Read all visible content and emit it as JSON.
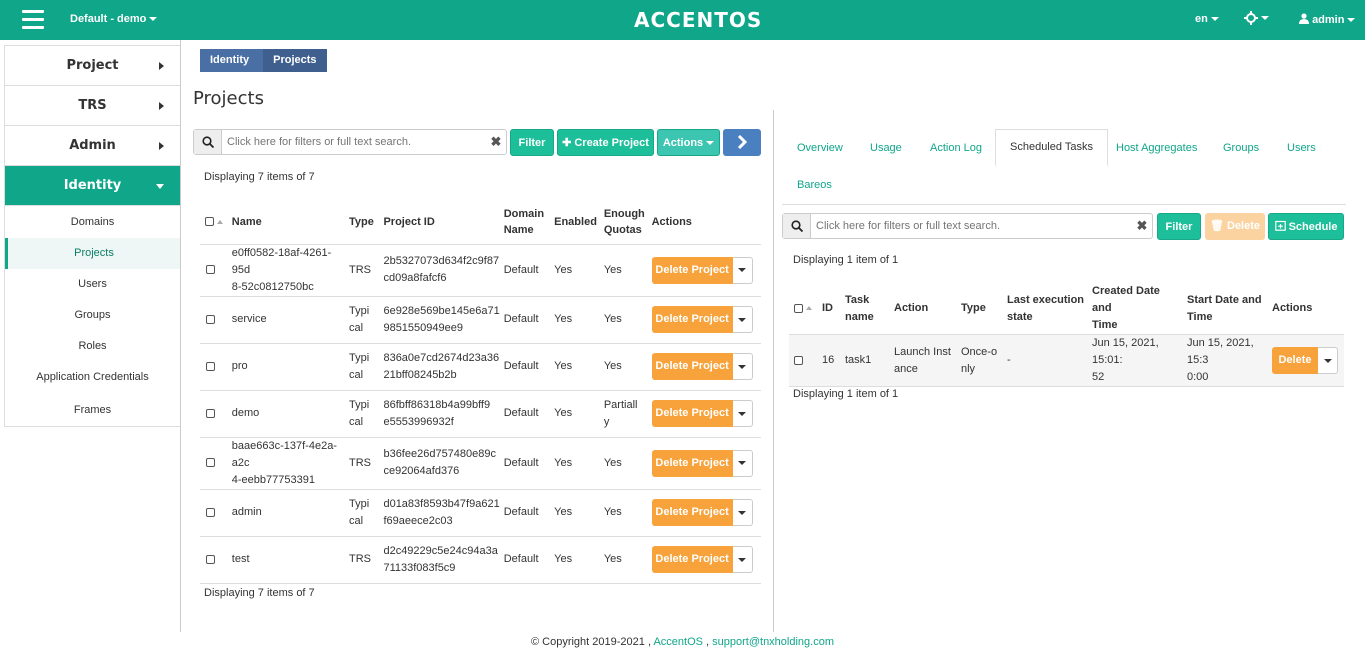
{
  "topbar": {
    "project": "Default - demo",
    "logo": "ACCENTOS",
    "lang": "en",
    "user": "admin"
  },
  "sidebar": {
    "categories": [
      {
        "label": "Project"
      },
      {
        "label": "TRS"
      },
      {
        "label": "Admin"
      },
      {
        "label": "Identity"
      }
    ],
    "items": [
      {
        "label": "Domains"
      },
      {
        "label": "Projects"
      },
      {
        "label": "Users"
      },
      {
        "label": "Groups"
      },
      {
        "label": "Roles"
      },
      {
        "label": "Application Credentials"
      },
      {
        "label": "Frames"
      }
    ]
  },
  "breadcrumb": {
    "root": "Identity",
    "current": "Projects"
  },
  "page": {
    "title": "Projects"
  },
  "left": {
    "search_placeholder": "Click here for filters or full text search.",
    "filter": "Filter",
    "create": "Create Project",
    "actions": "Actions",
    "count_top": "Displaying 7 items of 7",
    "count_bottom": "Displaying 7 items of 7",
    "headers": {
      "name": "Name",
      "type": "Type",
      "id": "Project ID",
      "domain1": "Domain",
      "domain2": "Name",
      "enabled": "Enabled",
      "quotas1": "Enough",
      "quotas2": "Quotas",
      "actions": "Actions"
    },
    "rows": [
      {
        "name1": "e0ff0582-18af-4261-95d",
        "name2": "8-52c0812750bc",
        "type1": "TRS",
        "type2": "",
        "id1": "2b5327073d634f2c9f87",
        "id2": "cd09a8fafcf6",
        "domain": "Default",
        "enabled": "Yes",
        "q1": "Yes",
        "q2": "",
        "qclass": "blu",
        "action": "Delete Project"
      },
      {
        "name1": "service",
        "name2": "",
        "type1": "Typi",
        "type2": "cal",
        "id1": "6e928e569be145e6a71",
        "id2": "9851550949ee9",
        "domain": "Default",
        "enabled": "Yes",
        "q1": "Yes",
        "q2": "",
        "qclass": "blu",
        "action": "Delete Project"
      },
      {
        "name1": "pro",
        "name2": "",
        "type1": "Typi",
        "type2": "cal",
        "id1": "836a0e7cd2674d23a36",
        "id2": "21bff08245b2b",
        "domain": "Default",
        "enabled": "Yes",
        "q1": "Yes",
        "q2": "",
        "qclass": "blu",
        "action": "Delete Project"
      },
      {
        "name1": "demo",
        "name2": "",
        "type1": "Typi",
        "type2": "cal",
        "id1": "86fbff86318b4a99bff9",
        "id2": "e5553996932f",
        "domain": "Default",
        "enabled": "Yes",
        "q1": "Partiall",
        "q2": "y",
        "qclass": "red",
        "action": "Delete Project"
      },
      {
        "name1": "baae663c-137f-4e2a-a2c",
        "name2": "4-eebb77753391",
        "type1": "TRS",
        "type2": "",
        "id1": "b36fee26d757480e89c",
        "id2": "ce92064afd376",
        "domain": "Default",
        "enabled": "Yes",
        "q1": "Yes",
        "q2": "",
        "qclass": "blu",
        "action": "Delete Project"
      },
      {
        "name1": "admin",
        "name2": "",
        "type1": "Typi",
        "type2": "cal",
        "id1": "d01a83f8593b47f9a621",
        "id2": "f69aeece2c03",
        "domain": "Default",
        "enabled": "Yes",
        "q1": "Yes",
        "q2": "",
        "qclass": "blu",
        "action": "Delete Project"
      },
      {
        "name1": "test",
        "name2": "",
        "type1": "TRS",
        "type2": "",
        "id1": "d2c49229c5e24c94a3a",
        "id2": "71133f083f5c9",
        "domain": "Default",
        "enabled": "Yes",
        "q1": "Yes",
        "q2": "",
        "qclass": "blu",
        "action": "Delete Project"
      }
    ]
  },
  "right": {
    "tabs": [
      "Overview",
      "Usage",
      "Action Log",
      "Scheduled Tasks",
      "Host Aggregates",
      "Groups",
      "Users",
      "Bareos"
    ],
    "search_placeholder": "Click here for filters or full text search.",
    "filter": "Filter",
    "delete": "Delete",
    "schedule": "Schedule",
    "count_top": "Displaying 1 item of 1",
    "count_bottom": "Displaying 1 item of 1",
    "headers": {
      "id": "ID",
      "task1": "Task",
      "task2": "name",
      "action": "Action",
      "type": "Type",
      "last1": "Last execution",
      "last2": "state",
      "created1": "Created Date and",
      "created2": "Time",
      "start1": "Start Date and",
      "start2": "Time",
      "actions": "Actions"
    },
    "row": {
      "id": "16",
      "name": "task1",
      "action1": "Launch Inst",
      "action2": "ance",
      "type1": "Once-o",
      "type2": "nly",
      "state": "-",
      "created1": "Jun 15, 2021, 15:01:",
      "created2": "52",
      "start1": "Jun 15, 2021, 15:3",
      "start2": "0:00",
      "btn": "Delete"
    }
  },
  "footer": {
    "copy": "© Copyright 2019-2021 , ",
    "brand": "AccentOS",
    "sep": " , ",
    "email": "support@tnxholding.com"
  }
}
